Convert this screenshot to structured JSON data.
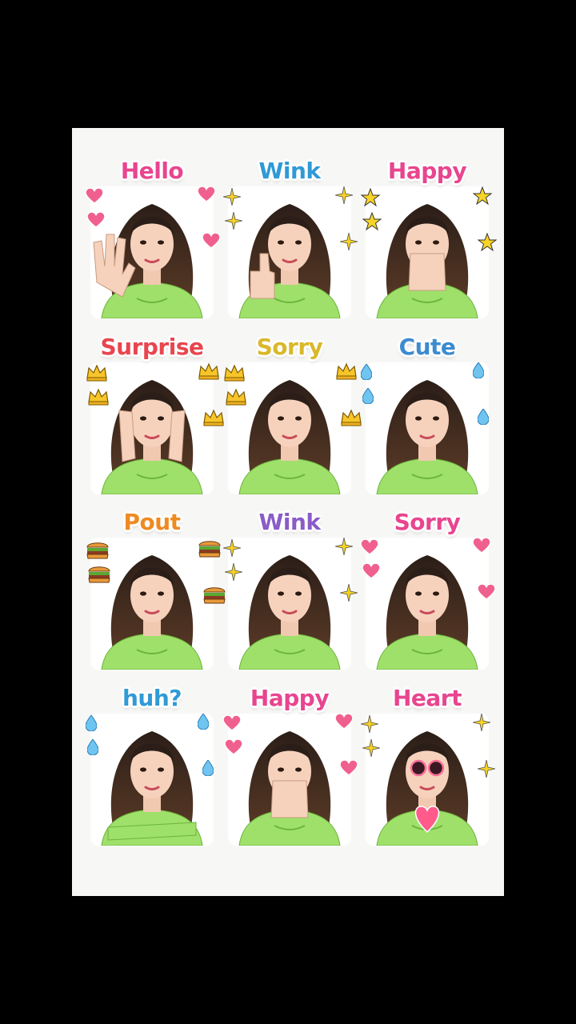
{
  "sticker_sheet": {
    "stickers": [
      {
        "label": "Hello",
        "color": "#e8458f",
        "decoration": "heart-icon",
        "gesture": "waving-hand"
      },
      {
        "label": "Wink",
        "color": "#2f9ad6",
        "decoration": "sparkle-icon",
        "gesture": "thumbs-up"
      },
      {
        "label": "Happy",
        "color": "#e8458f",
        "decoration": "star-icon",
        "gesture": "hands-over-mouth"
      },
      {
        "label": "Surprise",
        "color": "#e8464f",
        "decoration": "crown-icon",
        "gesture": "hands-on-cheeks"
      },
      {
        "label": "Sorry",
        "color": "#d9b82a",
        "decoration": "crown-icon",
        "gesture": "none"
      },
      {
        "label": "Cute",
        "color": "#3b8bd0",
        "decoration": "droplet-icon",
        "gesture": "none"
      },
      {
        "label": "Pout",
        "color": "#ef8a22",
        "decoration": "burger-icon",
        "gesture": "none"
      },
      {
        "label": "Wink",
        "color": "#8a5cc8",
        "decoration": "sparkle-icon",
        "gesture": "none"
      },
      {
        "label": "Sorry",
        "color": "#e8458f",
        "decoration": "heart-icon",
        "gesture": "none"
      },
      {
        "label": "huh?",
        "color": "#2f9ad6",
        "decoration": "droplet-icon",
        "gesture": "crossed-arms"
      },
      {
        "label": "Happy",
        "color": "#e8458f",
        "decoration": "heart-icon",
        "gesture": "clasped-hands"
      },
      {
        "label": "Heart",
        "color": "#e8458f",
        "decoration": "sparkle-icon",
        "gesture": "heart-sunglasses"
      }
    ]
  }
}
